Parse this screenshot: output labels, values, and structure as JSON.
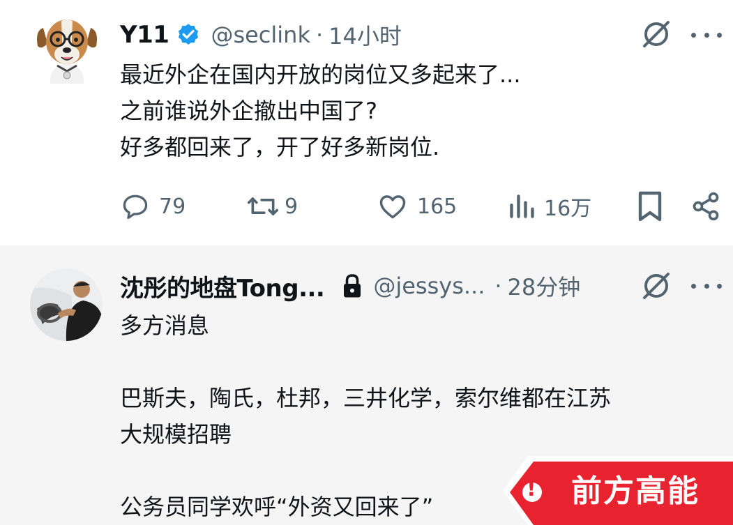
{
  "tweets": [
    {
      "author": "Y11",
      "verified": true,
      "handle": "@seclink",
      "separator": "·",
      "time": "14小时",
      "lines": [
        "最近外企在国内开放的岗位又多起来了...",
        "之前谁说外企撤出中国了?",
        "好多都回来了，开了好多新岗位."
      ],
      "actions": {
        "replies": "79",
        "reposts": "9",
        "likes": "165",
        "views": "16万"
      },
      "icons": [
        "grok-icon",
        "more-icon",
        "reply-icon",
        "repost-icon",
        "like-icon",
        "views-icon",
        "bookmark-icon",
        "share-icon"
      ]
    },
    {
      "author": "沈彤的地盘Tong...",
      "protected": true,
      "handle": "@jessys...",
      "separator": "·",
      "time": "28分钟",
      "lines": [
        "多方消息",
        "",
        "巴斯夫，陶氏，杜邦，三井化学，索尔维都在江苏",
        "大规模招聘",
        "",
        "公务员同学欢呼“外资又回来了”"
      ]
    }
  ],
  "sticker": {
    "text": "前方高能",
    "mark": "!"
  },
  "colors": {
    "text": "#0f1419",
    "secondary": "#536471",
    "verified": "#1d9bf0",
    "sticker": "#e8232f"
  }
}
